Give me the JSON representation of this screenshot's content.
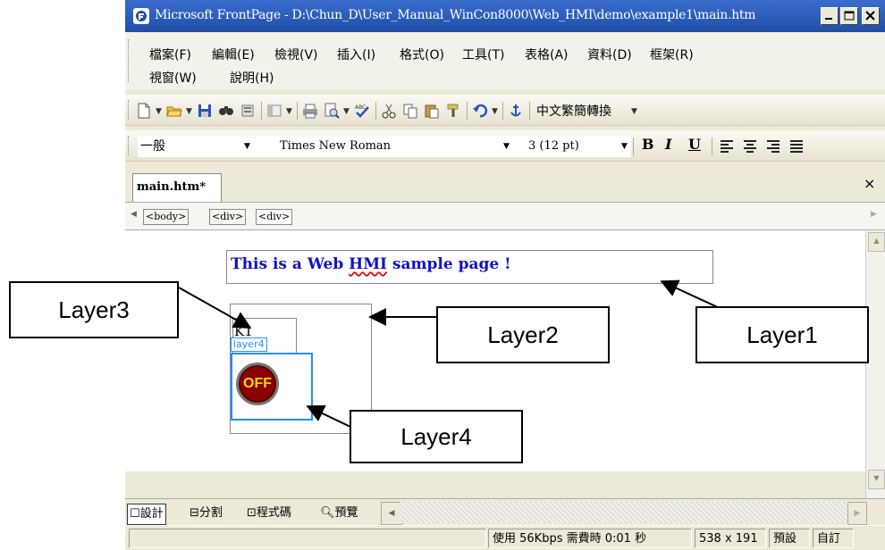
{
  "window": {
    "title": "Microsoft FrontPage - D:\\Chun_D\\User_Manual_WinCon8000\\Web_HMI\\demo\\example1\\main.htm",
    "accent": "#1f4fa7"
  },
  "menu": {
    "row1": [
      "檔案(F)",
      "編輯(E)",
      "檢視(V)",
      "插入(I)",
      "格式(O)",
      "工具(T)",
      "表格(A)",
      "資料(D)",
      "框架(R)"
    ],
    "row2": [
      "視窗(W)",
      "說明(H)"
    ]
  },
  "toolbar": {
    "icons": [
      "new-page-icon",
      "open-folder-icon",
      "save-icon",
      "find-icon",
      "print-preview-icon",
      "publish-icon",
      "print-icon",
      "preview-icon",
      "spelling-icon",
      "cut-icon",
      "copy-icon",
      "paste-icon",
      "format-painter-icon",
      "undo-icon",
      "hyperlink-icon"
    ],
    "convert_label": "中文繁簡轉換"
  },
  "format_bar": {
    "style_value": "一般",
    "font_value": "Times New Roman",
    "size_value": "3  (12 pt)",
    "bold": "B",
    "italic": "I",
    "underline": "U"
  },
  "document": {
    "tab_label": "main.htm*",
    "close_glyph": "×",
    "breadcrumbs": [
      "<body>",
      "<div>",
      "<div>"
    ]
  },
  "canvas": {
    "banner_prefix": "This is a Web ",
    "banner_hmi": "HMI",
    "banner_suffix": " sample page !",
    "k1_label": "K1",
    "layer4_label": "layer4",
    "button_label": "OFF",
    "button_color": "#8b0000",
    "button_text_color": "#ffd700",
    "selection_color": "#1e90ff"
  },
  "views": {
    "design": "設計",
    "split": "分割",
    "code": "程式碼",
    "preview": "預覽"
  },
  "status": {
    "speed": "使用 56Kbps 需費時 0:01 秒",
    "dimensions": "538 x 191",
    "default": "預設",
    "custom": "自訂"
  },
  "annotations": {
    "layer1": "Layer1",
    "layer2": "Layer2",
    "layer3": "Layer3",
    "layer4": "Layer4"
  }
}
